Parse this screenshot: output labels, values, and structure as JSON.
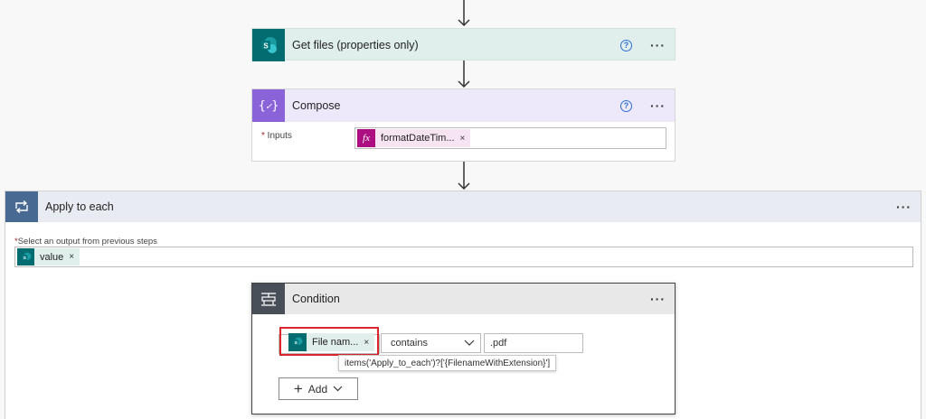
{
  "get_files": {
    "title": "Get files (properties only)",
    "icon": "sharepoint-icon",
    "color": "#e2f0ee"
  },
  "compose": {
    "title": "Compose",
    "icon": "compose-icon",
    "inputs_label": "Inputs",
    "token_label": "formatDateTim...",
    "token_icon": "fx"
  },
  "apply_each": {
    "title": "Apply to each",
    "select_label": "Select an output from previous steps",
    "token_label": "value"
  },
  "condition": {
    "title": "Condition",
    "token_label": "File nam...",
    "operator": "contains",
    "value": ".pdf",
    "tooltip": "items('Apply_to_each')?['{FilenameWithExtension}']",
    "add_label": "Add"
  },
  "icons": {
    "help": "?",
    "more": "···",
    "close": "×",
    "sharepoint": "S"
  }
}
